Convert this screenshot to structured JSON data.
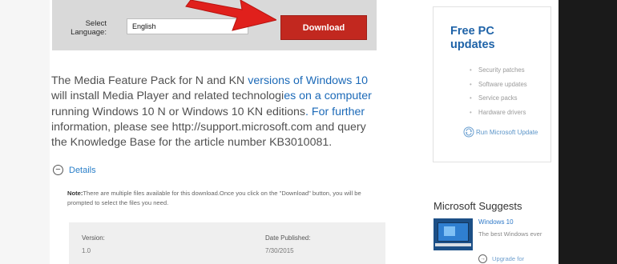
{
  "language_bar": {
    "label": "Select Language:",
    "selected": "English",
    "download_label": "Download"
  },
  "description": {
    "p1": "The Media Feature Pack for N and KN ",
    "p1_link": "versions of Windows 10",
    "p2": " will install Media Player and related technologi",
    "p2_link": "es on a computer",
    "p3": " running Windows 10 N or Windows 10 KN editions",
    "p3_link": ". For further",
    "p4": " information, please see http://support.microsoft.com and query the Knowledge Base for the article number KB3010081."
  },
  "details": {
    "label": "Details",
    "note_label": "Note:",
    "note_text": "There are multiple files available for this download.Once you click on the \"Download\" button, you will be prompted to select the files you need.",
    "version_label": "Version:",
    "version_value": "1.0",
    "date_label": "Date Published:",
    "date_value": "7/30/2015"
  },
  "sidebar": {
    "title": "Free PC updates",
    "items": [
      "Security patches",
      "Software updates",
      "Service packs",
      "Hardware drivers"
    ],
    "run_update": "Run Microsoft Update"
  },
  "suggests": {
    "title": "Microsoft Suggests",
    "product_name": "Windows 10",
    "product_desc": "The best Windows ever",
    "upgrade": "Upgrade for"
  },
  "colors": {
    "download_button": "#c2281f",
    "arrow": "#e0201c",
    "link": "#1c6ab8"
  }
}
